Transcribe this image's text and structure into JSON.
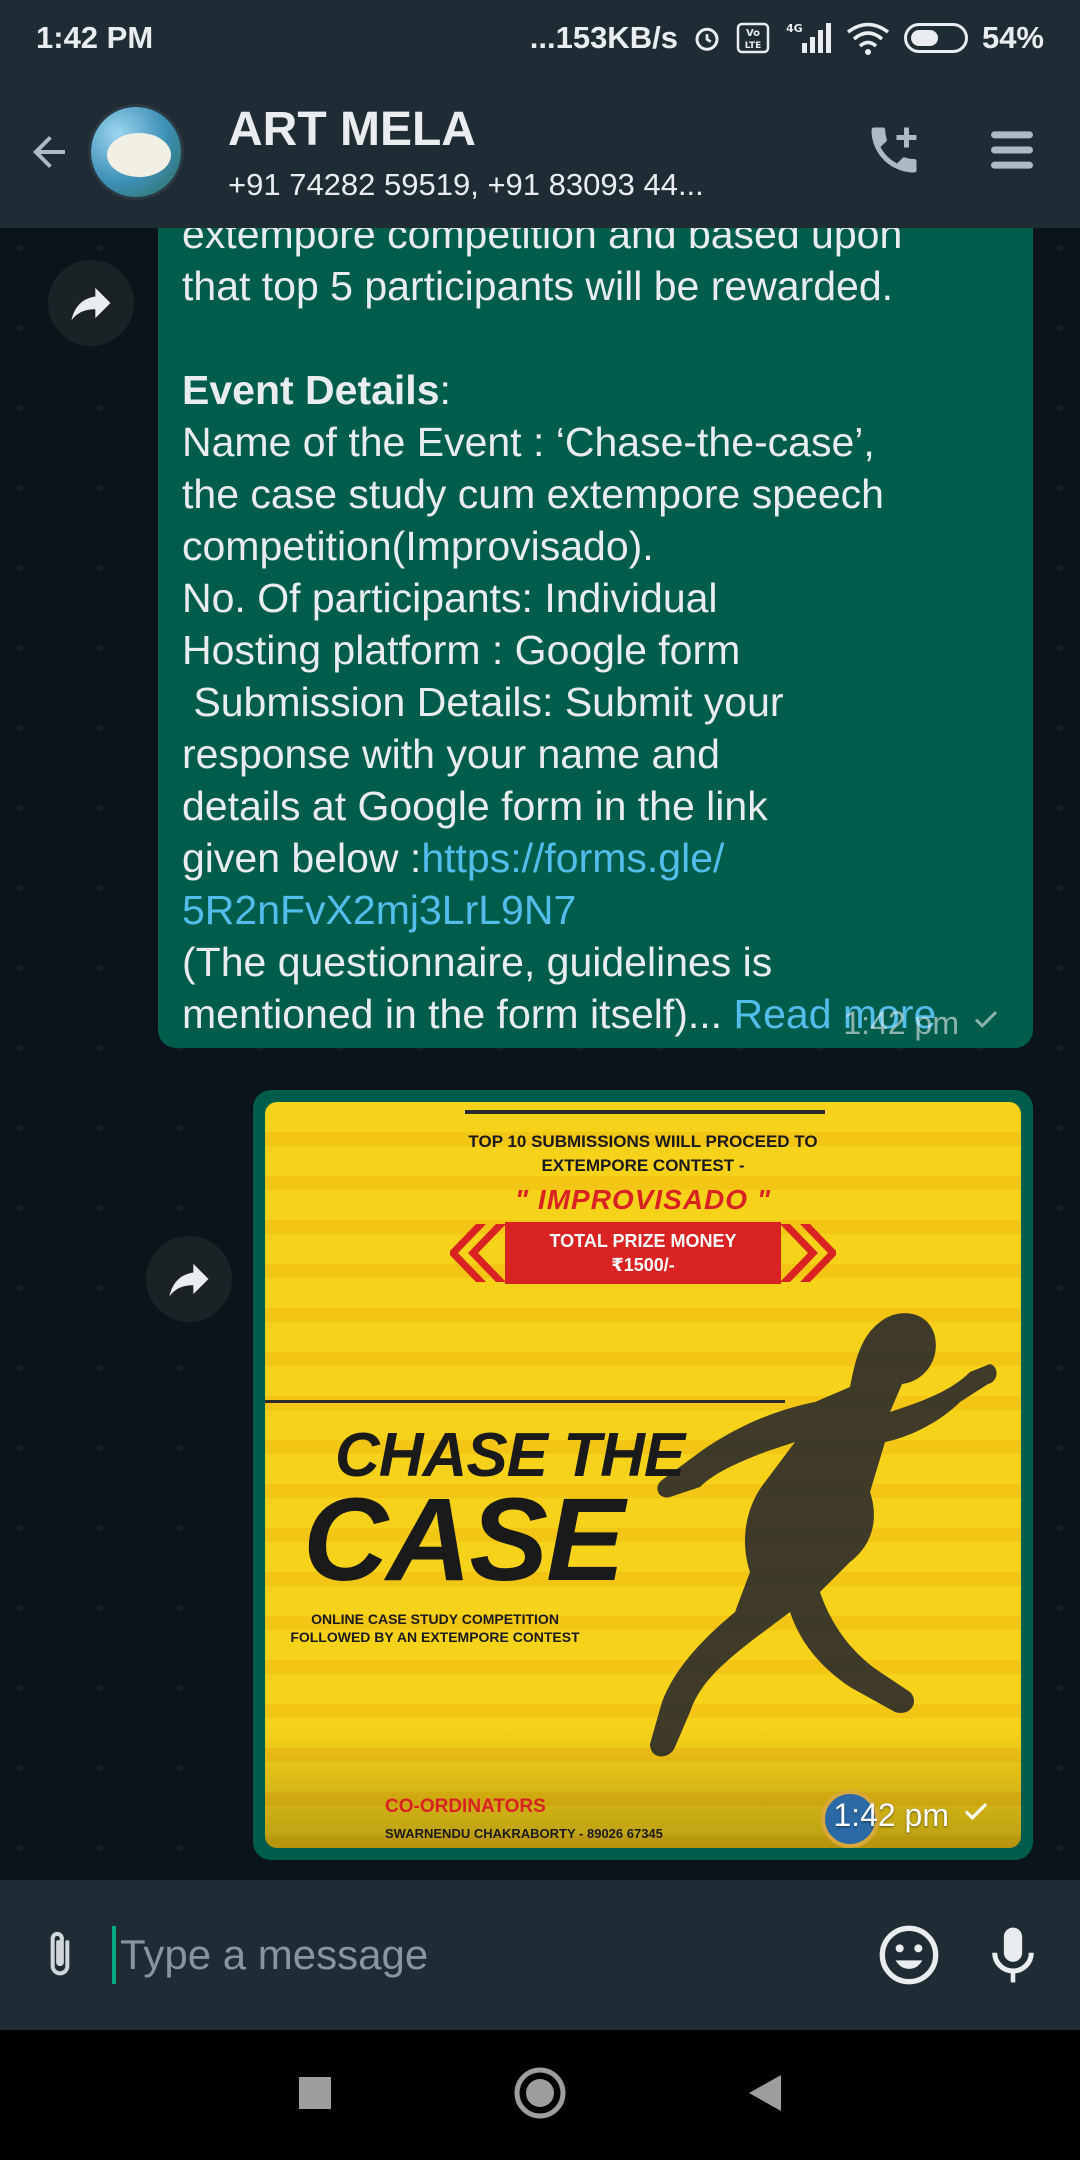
{
  "status_bar": {
    "time": "1:42 PM",
    "network_speed": "...153KB/s",
    "network_type": "4G",
    "battery": "54%",
    "battery_level": 0.54,
    "icons": [
      "alarm-icon",
      "volte-icon",
      "signal-icon",
      "wifi-icon",
      "battery-icon"
    ]
  },
  "header": {
    "title": "ART MELA",
    "subtitle": "+91 74282 59519, +91 83093 44..."
  },
  "message": {
    "cut_line": "extempore competition and based upon",
    "intro": "that top 5 participants will be rewarded.",
    "details_heading": "Event Details",
    "details_colon": ":",
    "lines": [
      "Name of the Event : ‘Chase-the-case’,",
      "the case study cum extempore speech",
      "competition(Improvisado).",
      "No. Of participants: Individual",
      "Hosting platform : Google form",
      " Submission Details: Submit your",
      "response with your name and",
      "details at Google form in the link"
    ],
    "link_prefix": "given below :",
    "link_part1": "https://forms.gle/",
    "link_part2": "5R2nFvX2mj3LrL9N7",
    "trailing_1": "(The questionnaire, guidelines is",
    "trailing_2": "mentioned in the form itself)...",
    "read_more": "Read more",
    "time": "1:42 pm"
  },
  "poster": {
    "headline_1": "TOP 10 SUBMISSIONS WIILL PROCEED TO",
    "headline_2": "EXTEMPORE CONTEST -",
    "improvisado": "\" IMPROVISADO \"",
    "prize_1": "TOTAL PRIZE MONEY",
    "prize_2": "₹1500/-",
    "title_1": "CHASE THE",
    "title_2": "CASE",
    "sub_1": "ONLINE CASE STUDY COMPETITION",
    "sub_2": "FOLLOWED BY AN EXTEMPORE CONTEST",
    "coord_label": "CO-ORDINATORS",
    "coord_name": "SWARNENDU CHAKRABORTY - 89026 67345",
    "time": "1:42 pm"
  },
  "composer": {
    "placeholder": "Type a message"
  },
  "colors": {
    "outgoing_bubble": "#005c4b",
    "app_bar": "#1f2c33",
    "link": "#53bdeb",
    "accent": "#00a884",
    "poster_yellow": "#f7d21a",
    "poster_red": "#d92323"
  }
}
